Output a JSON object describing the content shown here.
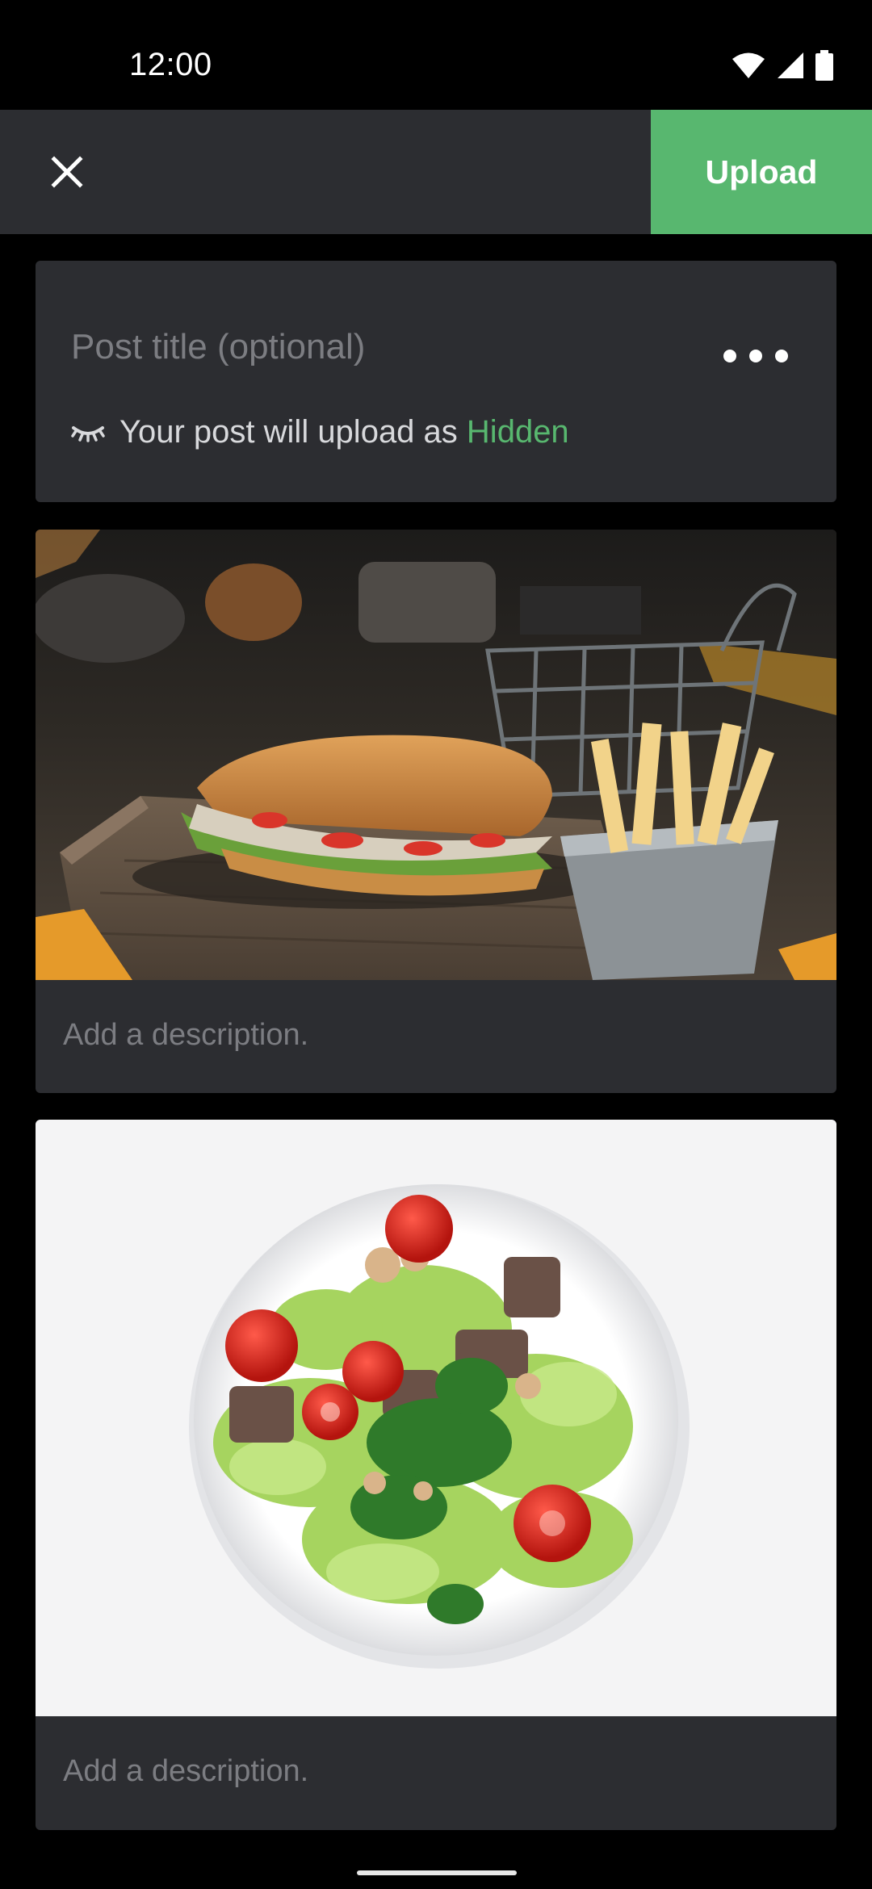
{
  "status_bar": {
    "time": "12:00",
    "icons": [
      "wifi-icon",
      "signal-icon",
      "battery-icon"
    ]
  },
  "header": {
    "close_icon": "close-icon",
    "upload_label": "Upload"
  },
  "post": {
    "title_placeholder": "Post title (optional)",
    "more_icon": "more-horizontal-icon",
    "visibility_icon": "eye-closed-icon",
    "visibility_prefix": "Your post will upload as",
    "visibility_value": "Hidden"
  },
  "media": [
    {
      "image": "sandwich-and-fries-photo",
      "description_placeholder": "Add a description."
    },
    {
      "image": "salad-bowl-photo",
      "description_placeholder": "Add a description."
    }
  ],
  "colors": {
    "accent": "#58b76f",
    "surface": "#2c2d31",
    "background": "#000000"
  }
}
